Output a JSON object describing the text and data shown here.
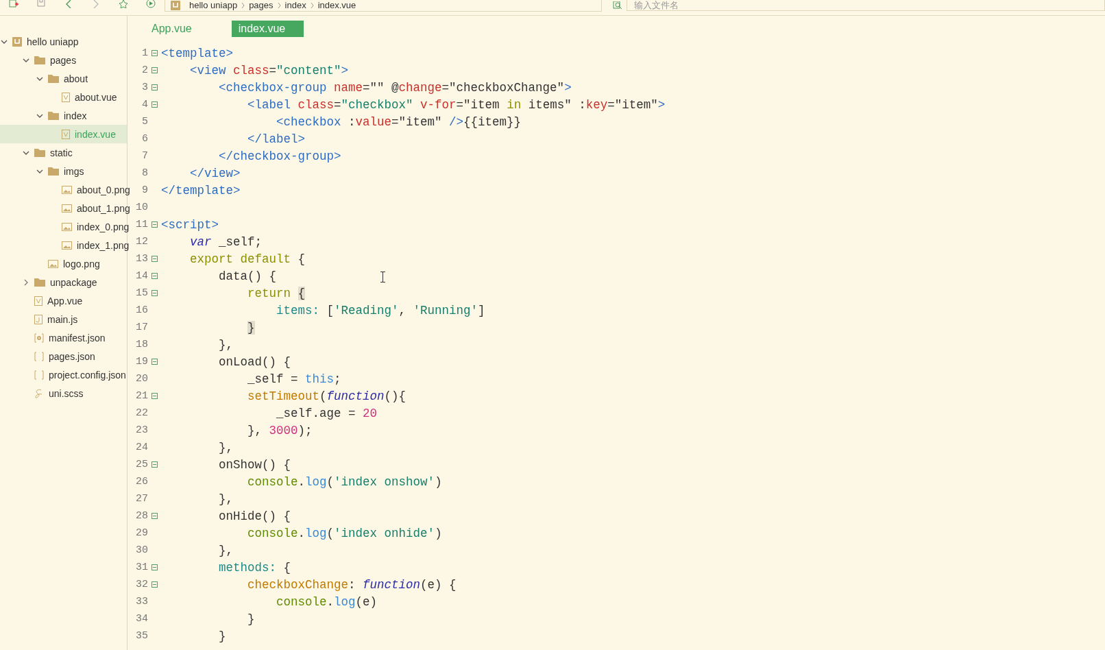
{
  "toolbar": {
    "breadcrumb": [
      "hello uniapp",
      "pages",
      "index",
      "index.vue"
    ],
    "search": {
      "placeholder": "输入文件名"
    }
  },
  "sidebar": {
    "items": [
      {
        "label": "hello uniapp",
        "kind": "project",
        "selected": false,
        "expanded": true,
        "children": [
          {
            "label": "pages",
            "kind": "folder",
            "selected": false,
            "expanded": true,
            "children": [
              {
                "label": "about",
                "kind": "folder",
                "selected": false,
                "expanded": true,
                "children": [
                  {
                    "label": "about.vue",
                    "kind": "vue",
                    "selected": false
                  }
                ]
              },
              {
                "label": "index",
                "kind": "folder",
                "selected": false,
                "expanded": true,
                "children": [
                  {
                    "label": "index.vue",
                    "kind": "vue",
                    "selected": true
                  }
                ]
              }
            ]
          },
          {
            "label": "static",
            "kind": "folder",
            "selected": false,
            "expanded": true,
            "children": [
              {
                "label": "imgs",
                "kind": "folder",
                "selected": false,
                "expanded": true,
                "children": [
                  {
                    "label": "about_0.png",
                    "kind": "image",
                    "selected": false
                  },
                  {
                    "label": "about_1.png",
                    "kind": "image",
                    "selected": false
                  },
                  {
                    "label": "index_0.png",
                    "kind": "image",
                    "selected": false
                  },
                  {
                    "label": "index_1.png",
                    "kind": "image",
                    "selected": false
                  }
                ]
              },
              {
                "label": "logo.png",
                "kind": "image",
                "selected": false
              }
            ]
          },
          {
            "label": "unpackage",
            "kind": "folder",
            "selected": false,
            "expanded": false
          },
          {
            "label": "App.vue",
            "kind": "vue",
            "selected": false
          },
          {
            "label": "main.js",
            "kind": "js",
            "selected": false
          },
          {
            "label": "manifest.json",
            "kind": "settings",
            "selected": false
          },
          {
            "label": "pages.json",
            "kind": "json",
            "selected": false
          },
          {
            "label": "project.config.json",
            "kind": "json",
            "selected": false
          },
          {
            "label": "uni.scss",
            "kind": "sass",
            "selected": false
          }
        ]
      }
    ]
  },
  "tabs": [
    {
      "label": "App.vue",
      "selected": false
    },
    {
      "label": "index.vue",
      "selected": true
    }
  ],
  "editor": {
    "lines": [
      {
        "number": "1",
        "foldable": true,
        "tokens": [
          {
            "kind": "tag",
            "text": "<template>"
          }
        ]
      },
      {
        "number": "2",
        "foldable": true,
        "tokens": [
          {
            "kind": "tag",
            "text": "    <view"
          },
          {
            "kind": "attr",
            "text": " class"
          },
          {
            "kind": "plain",
            "text": "="
          },
          {
            "kind": "str",
            "text": "\"content\""
          },
          {
            "kind": "tag",
            "text": ">"
          }
        ]
      },
      {
        "number": "3",
        "foldable": true,
        "tokens": [
          {
            "kind": "tag",
            "text": "        <checkbox-group"
          },
          {
            "kind": "attr",
            "text": " name"
          },
          {
            "kind": "plain",
            "text": "=\"\" @"
          },
          {
            "kind": "attr",
            "text": "change"
          },
          {
            "kind": "plain",
            "text": "=\"checkboxChange\""
          },
          {
            "kind": "tag",
            "text": ">"
          }
        ]
      },
      {
        "number": "4",
        "foldable": true,
        "tokens": [
          {
            "kind": "tag",
            "text": "            <label"
          },
          {
            "kind": "attr",
            "text": " class"
          },
          {
            "kind": "plain",
            "text": "="
          },
          {
            "kind": "str",
            "text": "\"checkbox\""
          },
          {
            "kind": "attr",
            "text": " v-for"
          },
          {
            "kind": "plain",
            "text": "=\"item "
          },
          {
            "kind": "kw",
            "text": "in"
          },
          {
            "kind": "plain",
            "text": " items\" :"
          },
          {
            "kind": "attr",
            "text": "key"
          },
          {
            "kind": "plain",
            "text": "=\"item\""
          },
          {
            "kind": "tag",
            "text": ">"
          }
        ]
      },
      {
        "number": "5",
        "foldable": false,
        "tokens": [
          {
            "kind": "tag",
            "text": "                <checkbox"
          },
          {
            "kind": "plain",
            "text": " :"
          },
          {
            "kind": "attr",
            "text": "value"
          },
          {
            "kind": "plain",
            "text": "=\"item\" "
          },
          {
            "kind": "tag",
            "text": "/>"
          },
          {
            "kind": "plain",
            "text": "{{item}}"
          }
        ]
      },
      {
        "number": "6",
        "foldable": false,
        "tokens": [
          {
            "kind": "tag",
            "text": "            </label>"
          }
        ]
      },
      {
        "number": "7",
        "foldable": false,
        "tokens": [
          {
            "kind": "tag",
            "text": "        </checkbox-group>"
          }
        ]
      },
      {
        "number": "8",
        "foldable": false,
        "tokens": [
          {
            "kind": "tag",
            "text": "    </view>"
          }
        ]
      },
      {
        "number": "9",
        "foldable": false,
        "tokens": [
          {
            "kind": "tag",
            "text": "</template>"
          }
        ]
      },
      {
        "number": "10",
        "foldable": false
      },
      {
        "number": "11",
        "foldable": true,
        "tokens": [
          {
            "kind": "tag",
            "text": "<script>"
          }
        ]
      },
      {
        "number": "12",
        "foldable": false,
        "tokens": [
          {
            "kind": "ital",
            "text": "    var"
          },
          {
            "kind": "plain",
            "text": " _self;"
          }
        ]
      },
      {
        "number": "13",
        "foldable": true,
        "tokens": [
          {
            "kind": "kw",
            "text": "    export default"
          },
          {
            "kind": "plain",
            "text": " {"
          }
        ]
      },
      {
        "number": "14",
        "foldable": true,
        "tokens": [
          {
            "kind": "plain",
            "text": "        data() {"
          }
        ]
      },
      {
        "number": "15",
        "foldable": true,
        "tokens": [
          {
            "kind": "kw",
            "text": "            return "
          },
          {
            "kind": "match",
            "text": "{"
          }
        ]
      },
      {
        "number": "16",
        "foldable": false,
        "tokens": [
          {
            "kind": "prop",
            "text": "                items:"
          },
          {
            "kind": "plain",
            "text": " ["
          },
          {
            "kind": "str",
            "text": "'Reading'"
          },
          {
            "kind": "plain",
            "text": ", "
          },
          {
            "kind": "str",
            "text": "'Running'"
          },
          {
            "kind": "plain",
            "text": "]"
          }
        ]
      },
      {
        "number": "17",
        "foldable": false,
        "tokens": [
          {
            "kind": "match",
            "text": "            }"
          }
        ]
      },
      {
        "number": "18",
        "foldable": false,
        "tokens": [
          {
            "kind": "plain",
            "text": "        },"
          }
        ]
      },
      {
        "number": "19",
        "foldable": true,
        "tokens": [
          {
            "kind": "plain",
            "text": "        onLoad() {"
          }
        ]
      },
      {
        "number": "20",
        "foldable": false,
        "tokens": [
          {
            "kind": "plain",
            "text": "            _self = "
          },
          {
            "kind": "builtin",
            "text": "this"
          },
          {
            "kind": "plain",
            "text": ";"
          }
        ]
      },
      {
        "number": "21",
        "foldable": true,
        "tokens": [
          {
            "kind": "fn",
            "text": "            setTimeout"
          },
          {
            "kind": "plain",
            "text": "("
          },
          {
            "kind": "ital",
            "text": "function"
          },
          {
            "kind": "plain",
            "text": "(){"
          }
        ]
      },
      {
        "number": "22",
        "foldable": false,
        "tokens": [
          {
            "kind": "plain",
            "text": "                _self.age = "
          },
          {
            "kind": "num",
            "text": "20"
          }
        ]
      },
      {
        "number": "23",
        "foldable": false,
        "tokens": [
          {
            "kind": "plain",
            "text": "            }, "
          },
          {
            "kind": "num",
            "text": "3000"
          },
          {
            "kind": "plain",
            "text": ");"
          }
        ]
      },
      {
        "number": "24",
        "foldable": false,
        "tokens": [
          {
            "kind": "plain",
            "text": "        },"
          }
        ]
      },
      {
        "number": "25",
        "foldable": true,
        "tokens": [
          {
            "kind": "plain",
            "text": "        onShow() {"
          }
        ]
      },
      {
        "number": "26",
        "foldable": false,
        "tokens": [
          {
            "kind": "obj",
            "text": "            console"
          },
          {
            "kind": "plain",
            "text": "."
          },
          {
            "kind": "builtin",
            "text": "log"
          },
          {
            "kind": "plain",
            "text": "("
          },
          {
            "kind": "str",
            "text": "'index onshow'"
          },
          {
            "kind": "plain",
            "text": ")"
          }
        ]
      },
      {
        "number": "27",
        "foldable": false,
        "tokens": [
          {
            "kind": "plain",
            "text": "        },"
          }
        ]
      },
      {
        "number": "28",
        "foldable": true,
        "tokens": [
          {
            "kind": "plain",
            "text": "        onHide() {"
          }
        ]
      },
      {
        "number": "29",
        "foldable": false,
        "tokens": [
          {
            "kind": "obj",
            "text": "            console"
          },
          {
            "kind": "plain",
            "text": "."
          },
          {
            "kind": "builtin",
            "text": "log"
          },
          {
            "kind": "plain",
            "text": "("
          },
          {
            "kind": "str",
            "text": "'index onhide'"
          },
          {
            "kind": "plain",
            "text": ")"
          }
        ]
      },
      {
        "number": "30",
        "foldable": false,
        "tokens": [
          {
            "kind": "plain",
            "text": "        },"
          }
        ]
      },
      {
        "number": "31",
        "foldable": true,
        "tokens": [
          {
            "kind": "prop",
            "text": "        methods:"
          },
          {
            "kind": "plain",
            "text": " {"
          }
        ]
      },
      {
        "number": "32",
        "foldable": true,
        "tokens": [
          {
            "kind": "fn",
            "text": "            checkboxChange"
          },
          {
            "kind": "plain",
            "text": ": "
          },
          {
            "kind": "ital",
            "text": "function"
          },
          {
            "kind": "plain",
            "text": "(e) {"
          }
        ]
      },
      {
        "number": "33",
        "foldable": false,
        "tokens": [
          {
            "kind": "obj",
            "text": "                console"
          },
          {
            "kind": "plain",
            "text": "."
          },
          {
            "kind": "builtin",
            "text": "log"
          },
          {
            "kind": "plain",
            "text": "(e)"
          }
        ]
      },
      {
        "number": "34",
        "foldable": false,
        "tokens": [
          {
            "kind": "plain",
            "text": "            }"
          }
        ]
      },
      {
        "number": "35",
        "foldable": false,
        "tokens": [
          {
            "kind": "plain",
            "text": "        }"
          }
        ]
      }
    ]
  }
}
